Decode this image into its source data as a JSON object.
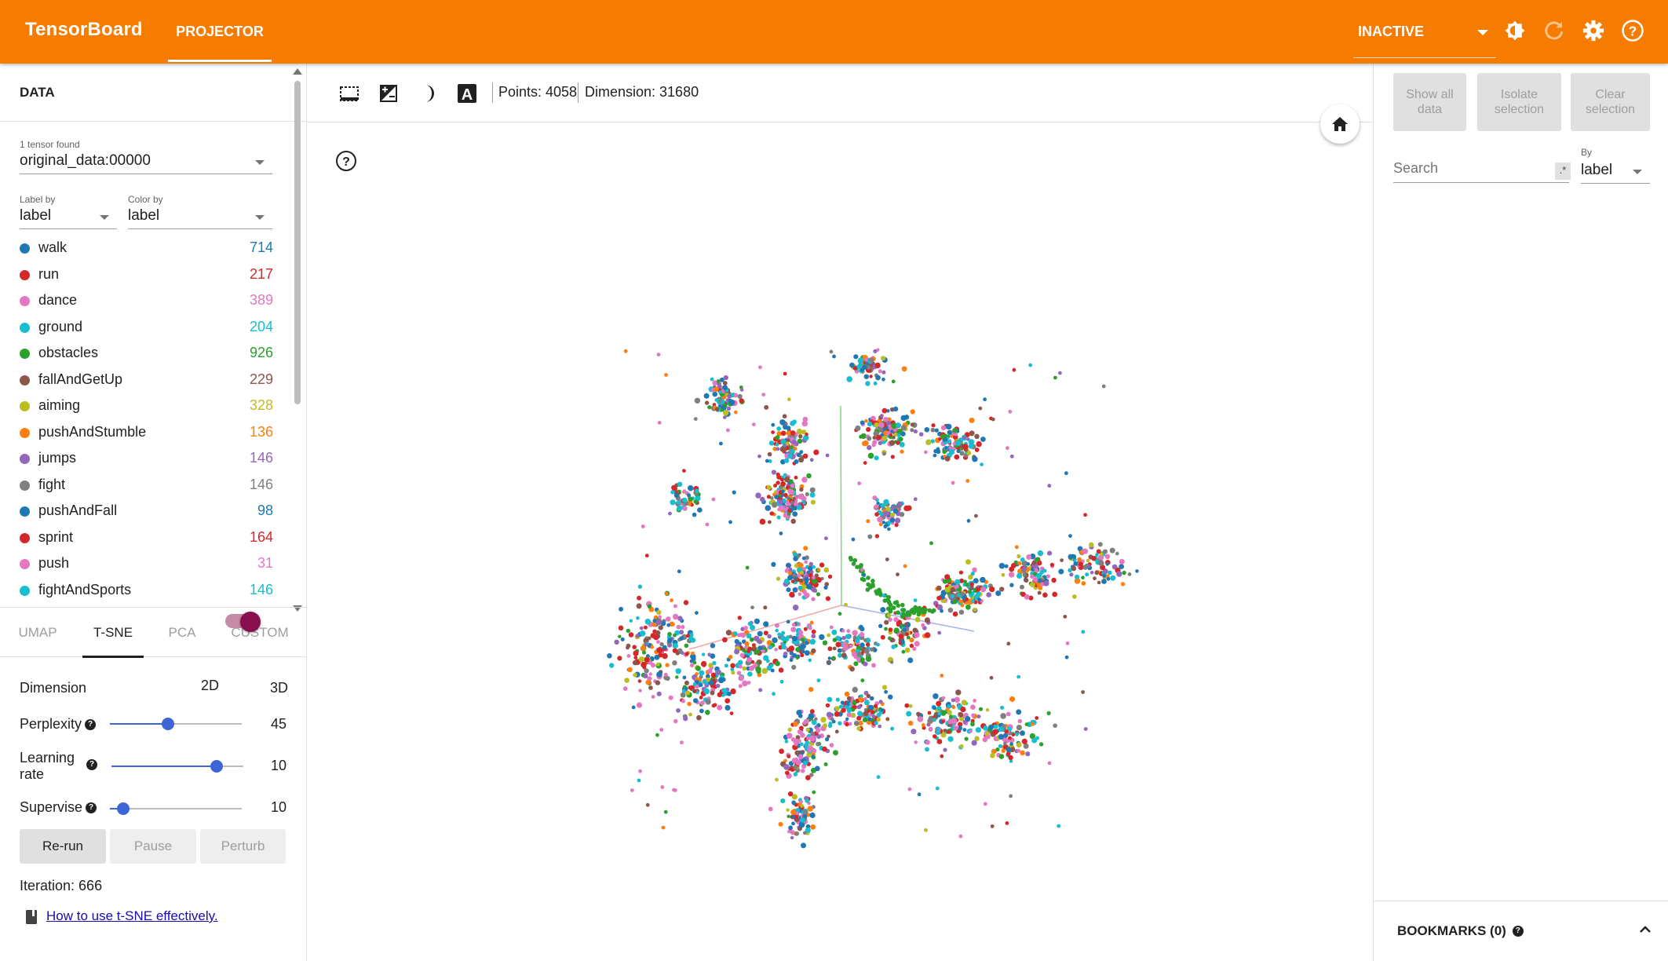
{
  "header": {
    "brand": "TensorBoard",
    "tab": "PROJECTOR",
    "run_status": "INACTIVE"
  },
  "data_panel": {
    "title": "DATA",
    "tensor_count": "1 tensor found",
    "tensor": "original_data:00000",
    "label_by_label": "Label by",
    "label_by_value": "label",
    "color_by_label": "Color by",
    "color_by_value": "label",
    "legend": [
      {
        "label": "walk",
        "count": "714",
        "color": "#1f77b4"
      },
      {
        "label": "run",
        "count": "217",
        "color": "#d62728"
      },
      {
        "label": "dance",
        "count": "389",
        "color": "#e377c2"
      },
      {
        "label": "ground",
        "count": "204",
        "color": "#17becf"
      },
      {
        "label": "obstacles",
        "count": "926",
        "color": "#2ca02c"
      },
      {
        "label": "fallAndGetUp",
        "count": "229",
        "color": "#8c564b"
      },
      {
        "label": "aiming",
        "count": "328",
        "color": "#bcbd22"
      },
      {
        "label": "pushAndStumble",
        "count": "136",
        "color": "#ff7f0e"
      },
      {
        "label": "jumps",
        "count": "146",
        "color": "#9467bd"
      },
      {
        "label": "fight",
        "count": "146",
        "color": "#7f7f7f"
      },
      {
        "label": "pushAndFall",
        "count": "98",
        "color": "#1f77b4"
      },
      {
        "label": "sprint",
        "count": "164",
        "color": "#d62728"
      },
      {
        "label": "push",
        "count": "31",
        "color": "#e377c2"
      },
      {
        "label": "fightAndSports",
        "count": "146",
        "color": "#17becf"
      }
    ]
  },
  "projection": {
    "tabs": [
      "UMAP",
      "T-SNE",
      "PCA",
      "CUSTOM"
    ],
    "active_tab": "T-SNE",
    "dimension_label": "Dimension",
    "dim_2d": "2D",
    "dim_3d": "3D",
    "perplexity_label": "Perplexity",
    "perplexity_value": "45",
    "perplexity_fraction": 0.44,
    "learning_rate_label": "Learning rate",
    "learning_rate_value": "10",
    "learning_rate_fraction": 0.8,
    "supervise_label": "Supervise",
    "supervise_value": "10",
    "supervise_fraction": 0.1,
    "rerun": "Re-run",
    "pause": "Pause",
    "perturb": "Perturb",
    "iteration": "Iteration: 666",
    "help_link": "How to use t-SNE effectively."
  },
  "toolbar": {
    "points": "Points: 4058",
    "dimension": "Dimension: 31680"
  },
  "inspector": {
    "show_all": "Show all data",
    "isolate": "Isolate selection",
    "clear": "Clear selection",
    "search_placeholder": "Search",
    "regex": ".*",
    "by_label": "By",
    "by_value": "label",
    "bookmarks": "BOOKMARKS (0)"
  },
  "colors": {
    "accent": "#f57c00",
    "slider": "#3d65d6",
    "toggle": "#880e4f"
  }
}
